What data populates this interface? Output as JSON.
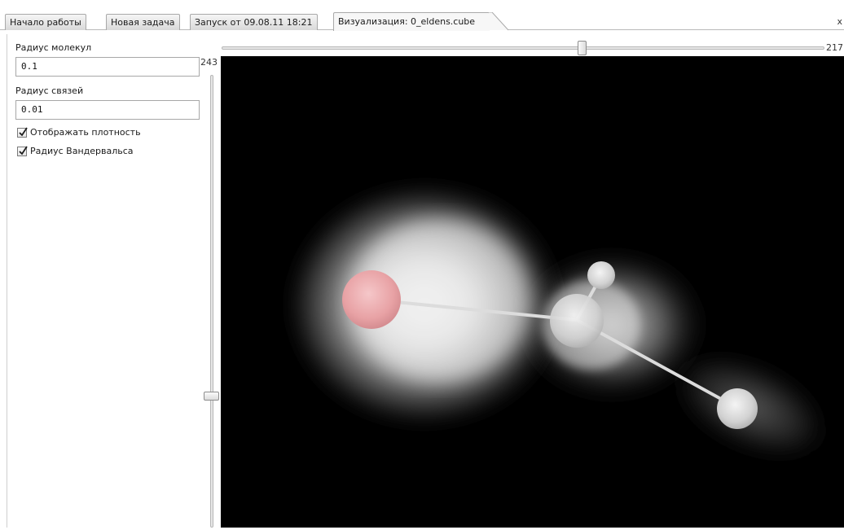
{
  "tabs": [
    {
      "label": "Начало работы"
    },
    {
      "label": "Новая задача"
    },
    {
      "label": "Запуск от 09.08.11 18:21"
    },
    {
      "label": "Визуализация: 0_eldens.cube"
    }
  ],
  "close_glyph": "x",
  "settings": {
    "molecule_radius_label": "Радиус молекул",
    "molecule_radius_value": "0.1",
    "bond_radius_label": "Радиус связей",
    "bond_radius_value": "0.01",
    "show_density_label": "Отображать плотность",
    "show_density_checked": true,
    "vdw_radius_label": "Радиус Вандервальса",
    "vdw_radius_checked": true
  },
  "vertical_slider": {
    "value_label": "243"
  },
  "horizontal_slider": {
    "value_label": "217"
  },
  "viewport": {
    "background": "#000000",
    "atom_colors": {
      "oxygen": "#e9a3a6",
      "other": "#d9d9d9"
    }
  },
  "icons": {
    "check": "check-icon",
    "close": "close-icon"
  }
}
